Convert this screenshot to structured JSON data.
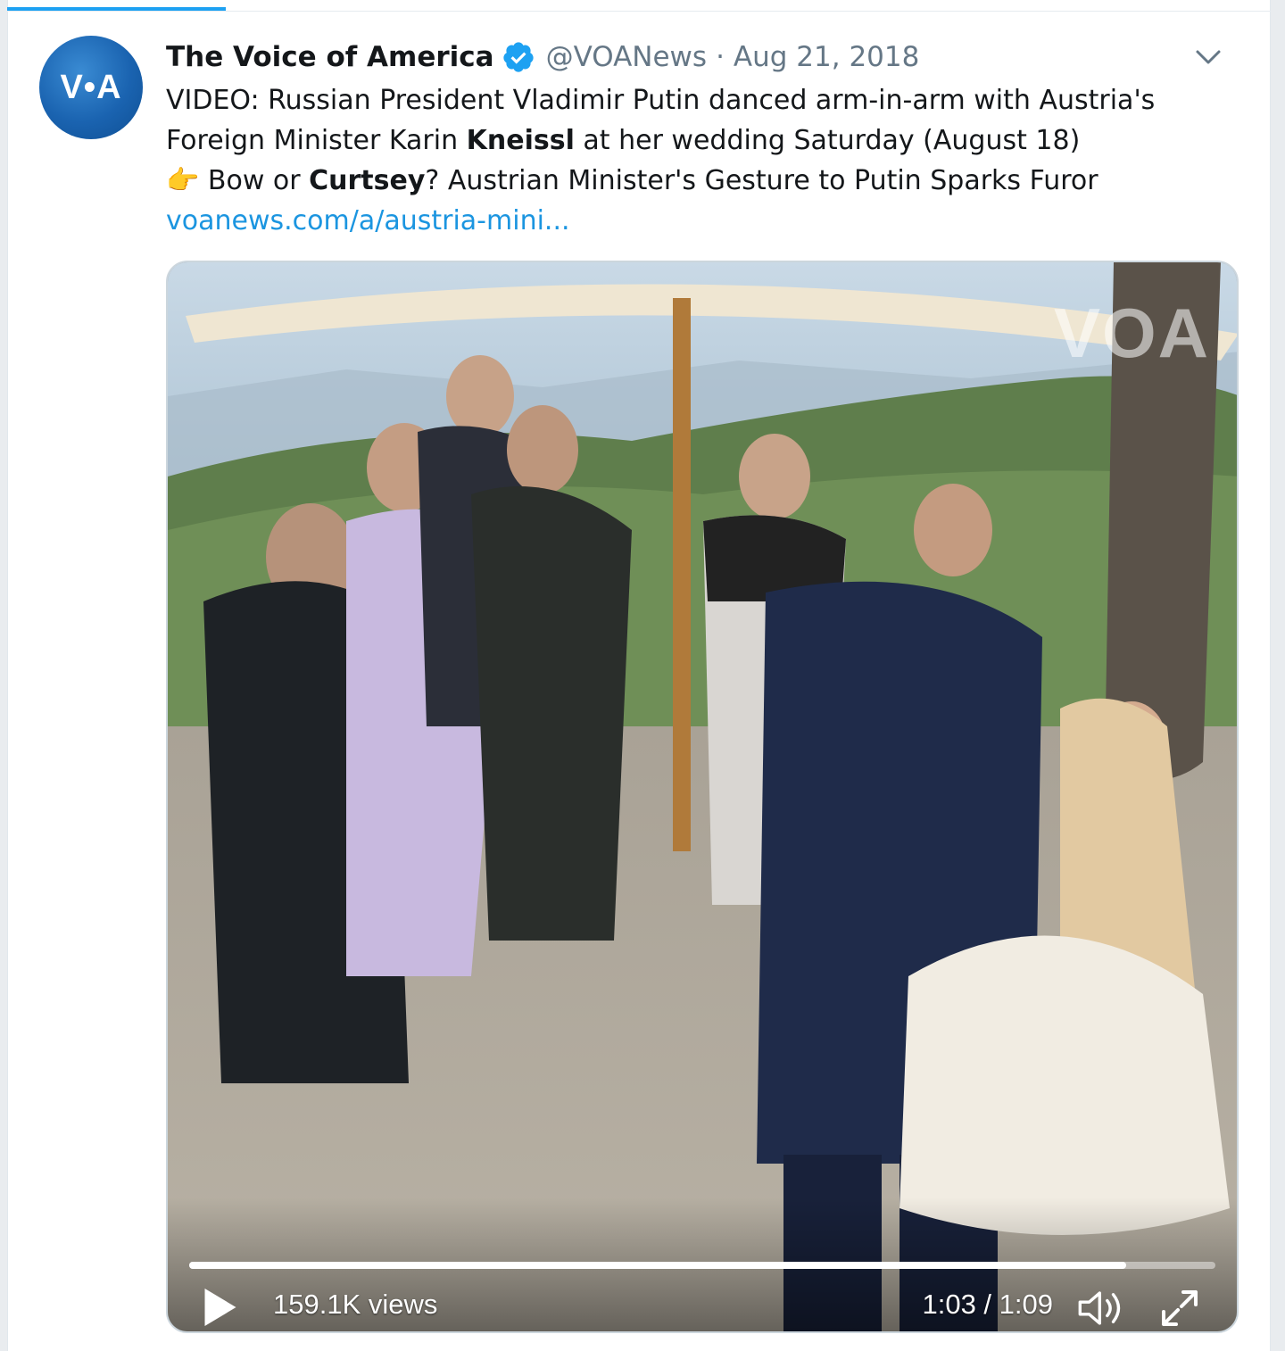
{
  "tweet": {
    "avatar_text": "V•A",
    "display_name": "The Voice of America",
    "handle": "@VOANews",
    "separator": "·",
    "date": "Aug 21, 2018",
    "lines": {
      "l1": "VIDEO: Russian President Vladimir Putin danced arm-in-arm with Austria's",
      "l2_a": "Foreign Minister Karin ",
      "l2_b": "Kneissl",
      "l2_c": " at her wedding Saturday (August 18)",
      "l3_emoji": "👉",
      "l3_a": " Bow or ",
      "l3_b": "Curtsey",
      "l3_c": "? Austrian Minister's Gesture to Putin Sparks Furor",
      "link": "voanews.com/a/austria-mini..."
    }
  },
  "video": {
    "watermark": "VOA",
    "views": "159.1K views",
    "time": "1:03 / 1:09",
    "progress_fraction": 0.913
  },
  "icons": {
    "verified": "verified-badge-icon",
    "caret": "chevron-down-icon",
    "play": "play-icon",
    "volume": "volume-icon",
    "fullscreen": "fullscreen-icon"
  },
  "colors": {
    "accent": "#1da1f2",
    "link": "#1b95e0",
    "muted": "#657786",
    "text": "#14171a"
  }
}
